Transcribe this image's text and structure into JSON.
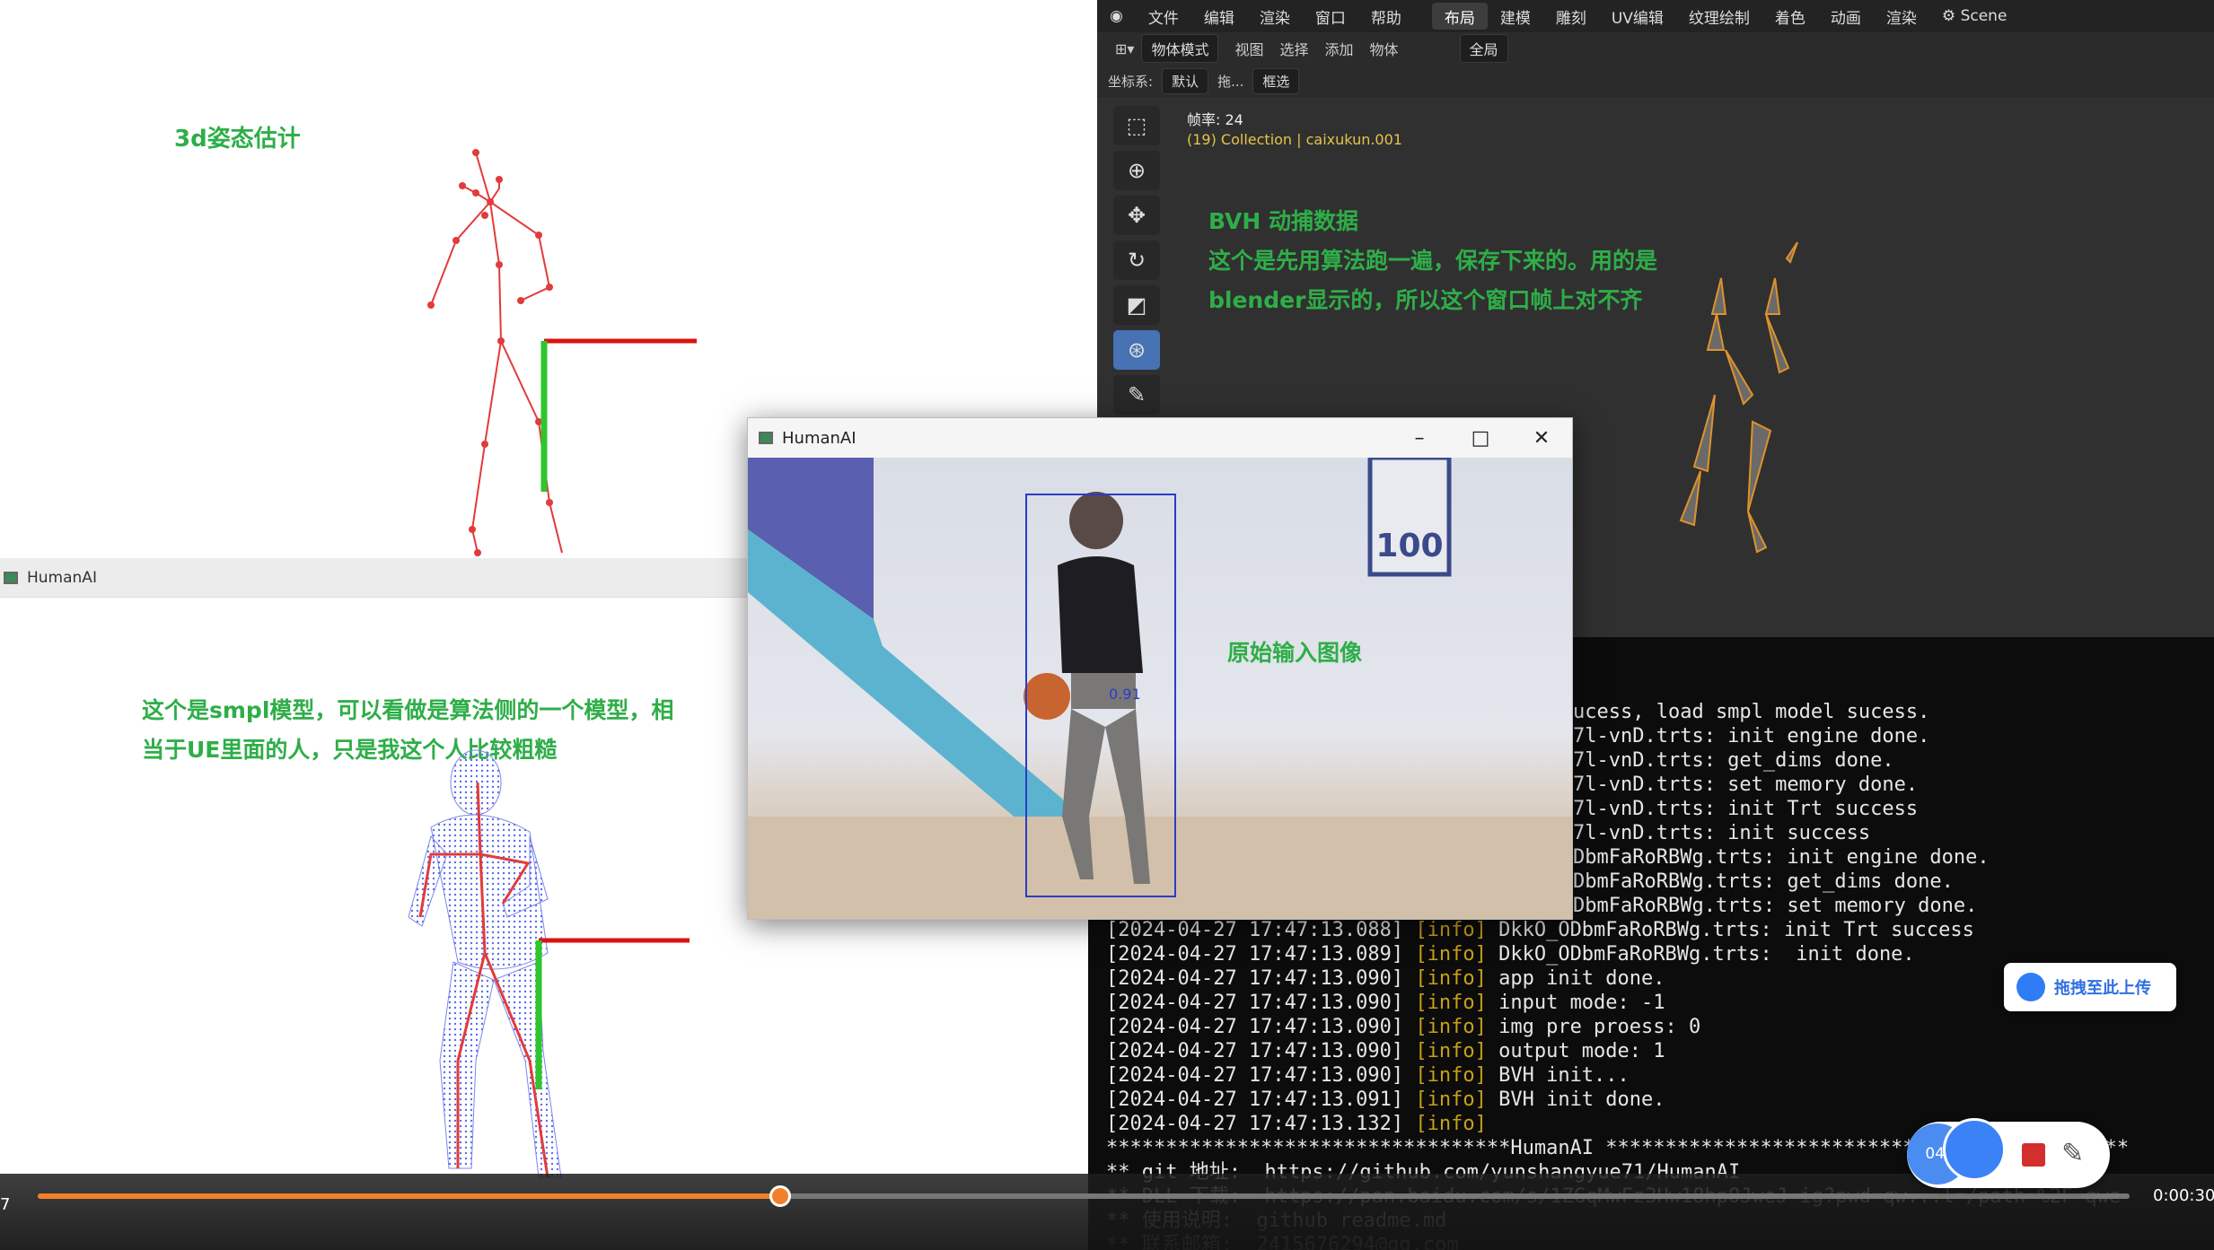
{
  "pose3d": {
    "annotation": "3d姿态估计"
  },
  "smpl": {
    "window_title": "HumanAI",
    "annotation_line1": "这个是smpl模型，可以看做是算法侧的一个模型，相",
    "annotation_line2": "当于UE里面的人，只是我这个人比较粗糙"
  },
  "blender": {
    "menus": [
      "文件",
      "编辑",
      "渲染",
      "窗口",
      "帮助"
    ],
    "workspaces": [
      "布局",
      "建模",
      "雕刻",
      "UV编辑",
      "纹理绘制",
      "着色",
      "动画",
      "渲染"
    ],
    "active_workspace": "布局",
    "scene": "Scene",
    "mode": "物体模式",
    "view_menus": [
      "视图",
      "选择",
      "添加",
      "物体"
    ],
    "global_label": "全局",
    "coord_label": "坐标系:",
    "coord_value": "默认",
    "drag_label": "拖...",
    "select_label": "框选",
    "fps_label": "帧率: 24",
    "collection_label": "(19) Collection | caixukun.001",
    "annotation_title": "BVH 动捕数据",
    "annotation_line1": "这个是先用算法跑一遍，保存下来的。用的是",
    "annotation_line2": "blender显示的，所以这个窗口帧上对不齐"
  },
  "humanai": {
    "title": "HumanAI",
    "minimize": "–",
    "maximize": "□",
    "close": "✕",
    "confidence": "0.91",
    "annotation": "原始输入图像",
    "scoreboard": "100"
  },
  "terminal": {
    "lines": [
      {
        "ts": "",
        "tag": "",
        "msg": "ucess, load smpl model sucess."
      },
      {
        "ts": "",
        "tag": "",
        "msg": "7l-vnD.trts: init engine done."
      },
      {
        "ts": "",
        "tag": "",
        "msg": "7l-vnD.trts: get_dims done."
      },
      {
        "ts": "",
        "tag": "",
        "msg": "7l-vnD.trts: set memory done."
      },
      {
        "ts": "",
        "tag": "",
        "msg": "7l-vnD.trts: init Trt success"
      },
      {
        "ts": "",
        "tag": "",
        "msg": "7l-vnD.trts: init success"
      },
      {
        "ts": "",
        "tag": "",
        "msg": "DbmFaRoRBWg.trts: init engine done."
      },
      {
        "ts": "",
        "tag": "",
        "msg": "DbmFaRoRBWg.trts: get_dims done."
      },
      {
        "ts": "",
        "tag": "",
        "msg": "DbmFaRoRBWg.trts: set memory done."
      },
      {
        "ts": "[2024-04-27 17:47:13.088]",
        "tag": "[info]",
        "msg": "DkkO_ODbmFaRoRBWg.trts: init Trt success"
      },
      {
        "ts": "[2024-04-27 17:47:13.089]",
        "tag": "[info]",
        "msg": "DkkO_ODbmFaRoRBWg.trts:  init done."
      },
      {
        "ts": "[2024-04-27 17:47:13.090]",
        "tag": "[info]",
        "msg": "app init done."
      },
      {
        "ts": "[2024-04-27 17:47:13.090]",
        "tag": "[info]",
        "msg": "input mode: -1"
      },
      {
        "ts": "[2024-04-27 17:47:13.090]",
        "tag": "[info]",
        "msg": "img pre proess: 0"
      },
      {
        "ts": "[2024-04-27 17:47:13.090]",
        "tag": "[info]",
        "msg": "output mode: 1"
      },
      {
        "ts": "[2024-04-27 17:47:13.090]",
        "tag": "[info]",
        "msg": "BVH init..."
      },
      {
        "ts": "[2024-04-27 17:47:13.091]",
        "tag": "[info]",
        "msg": "BVH init done."
      },
      {
        "ts": "[2024-04-27 17:47:13.132]",
        "tag": "[info]",
        "msg": ""
      },
      {
        "ts": "",
        "tag": "",
        "msg": "**********************************HumanAI ********************************************"
      },
      {
        "ts": "",
        "tag": "",
        "msg": "** git 地址:  https://github.com/yunshangyue71/HumanAI"
      },
      {
        "ts": "",
        "tag": "",
        "msg": "** DLL 下载:  https://pan.baidu.com/s/1ZGqMwFz3Hw18hpOJweJ-ig?pwd=qw...l=/path=%2F qwe"
      },
      {
        "ts": "",
        "tag": "",
        "msg": "** 使用说明:  github readme.md"
      },
      {
        "ts": "",
        "tag": "",
        "msg": "** 联系邮箱:  2415676294@qq.com"
      }
    ]
  },
  "player": {
    "time_left": "7",
    "time_right": "0:00:30",
    "progress": 0.355,
    "rec_time": "04:"
  },
  "upload": {
    "label": "拖拽至此上传"
  }
}
